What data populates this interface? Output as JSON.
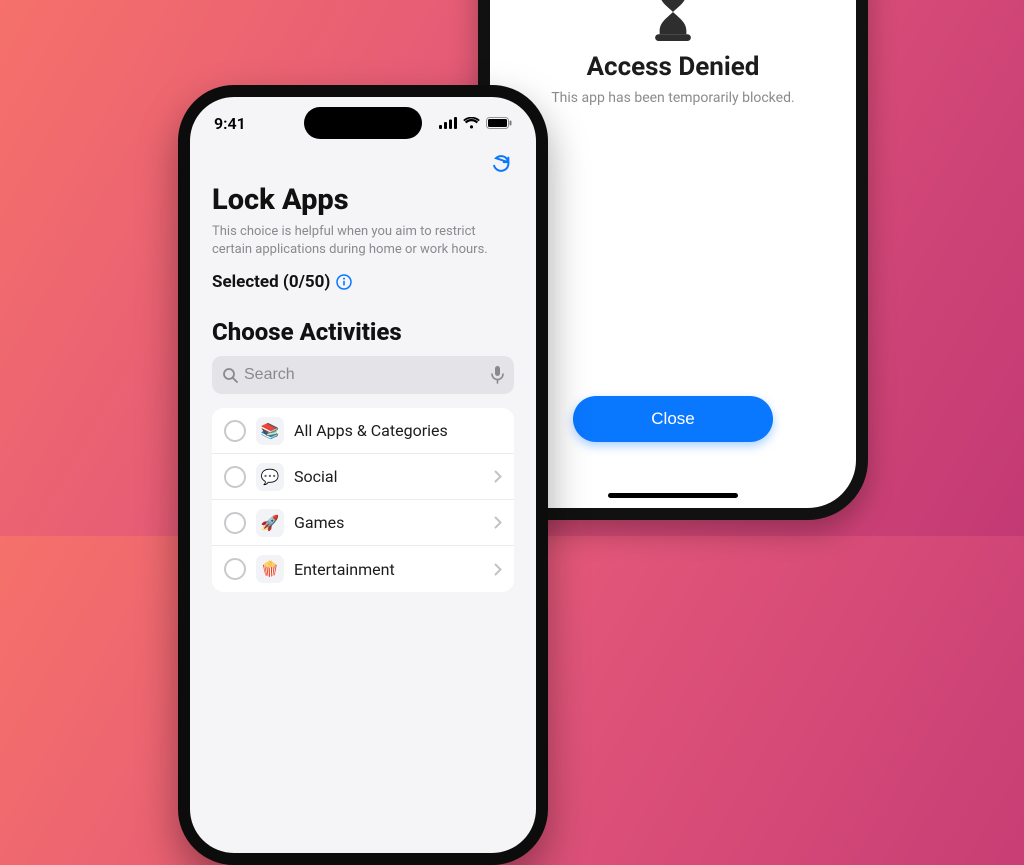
{
  "phone2": {
    "title": "Access Denied",
    "subtitle": "This app has been temporarily blocked.",
    "close_label": "Close"
  },
  "phone1": {
    "status": {
      "time": "9:41"
    },
    "title": "Lock Apps",
    "subtitle": "This choice is helpful when you aim to restrict certain applications during home or work hours.",
    "selected_label": "Selected (0/50)",
    "section": "Choose Activities",
    "search_placeholder": "Search",
    "list": [
      {
        "label": "All Apps & Categories",
        "emoji": "📚"
      },
      {
        "label": "Social",
        "emoji": "💬"
      },
      {
        "label": "Games",
        "emoji": "🚀"
      },
      {
        "label": "Entertainment",
        "emoji": "🍿"
      }
    ]
  }
}
